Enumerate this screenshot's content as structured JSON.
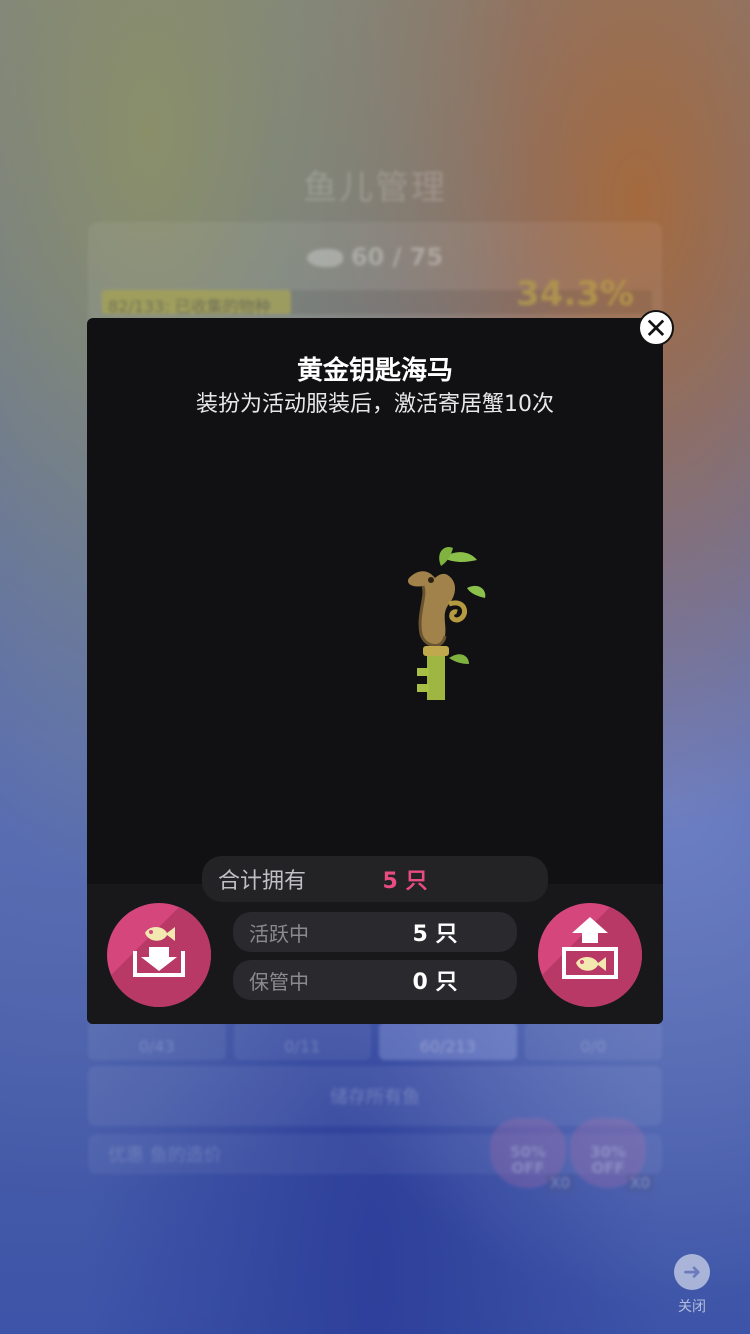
{
  "background": {
    "title": "鱼儿管理",
    "fish_count": "60 / 75",
    "progress_text": "82/133: 已收集的物种",
    "progress_fraction": 0.343,
    "percent": "34.3%",
    "tabs": [
      {
        "value": "0/43"
      },
      {
        "value": "0/11"
      },
      {
        "value": "60/213"
      },
      {
        "value": "0/0"
      }
    ],
    "store_all": "储存所有鱼",
    "discount_label": "优惠 鱼的造价",
    "discounts": [
      {
        "percent": "50%",
        "off": "OFF",
        "count": "X0"
      },
      {
        "percent": "30%",
        "off": "OFF",
        "count": "X0"
      }
    ],
    "close_label": "关闭"
  },
  "modal": {
    "title": "黄金钥匙海马",
    "subtitle": "装扮为活动服装后，激活寄居蟹10次",
    "total_label": "合计拥有",
    "total_value": "5 只",
    "active_label": "活跃中",
    "active_value": "5 只",
    "stored_label": "保管中",
    "stored_value": "0 只"
  },
  "colors": {
    "accent_pink": "#d4467c",
    "total_value_color": "#e94c80",
    "progress_fill": "#b8b04a"
  }
}
